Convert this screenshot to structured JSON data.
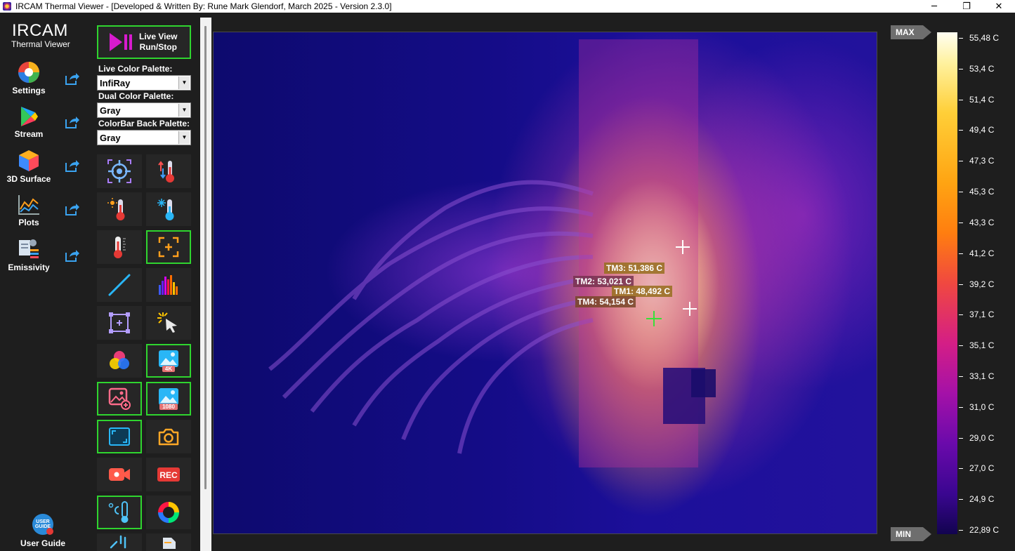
{
  "window": {
    "title": "IRCAM Thermal Viewer - [Developed & Written By: Rune Mark Glendorf, March 2025 - Version 2.3.0]",
    "minimize": "─",
    "maximize": "❐",
    "close": "✕"
  },
  "logo": {
    "title": "IRCAM",
    "subtitle": "Thermal Viewer"
  },
  "nav": [
    {
      "label": "Settings",
      "icon": "settings-icon"
    },
    {
      "label": "Stream",
      "icon": "play-stream-icon"
    },
    {
      "label": "3D Surface",
      "icon": "cube-icon"
    },
    {
      "label": "Plots",
      "icon": "chart-icon"
    },
    {
      "label": "Emissivity",
      "icon": "emissivity-icon"
    }
  ],
  "user_guide": {
    "label": "User Guide",
    "badge_line1": "USER",
    "badge_line2": "GUIDE"
  },
  "live_view": {
    "line1": "Live View",
    "line2": "Run/Stop"
  },
  "palettes": {
    "live_label": "Live Color Palette:",
    "live_value": "InfiRay",
    "dual_label": "Dual Color Palette:",
    "dual_value": "Gray",
    "colorbar_label": "ColorBar Back Palette:",
    "colorbar_value": "Gray"
  },
  "tool_text": {
    "rec": "REC",
    "res4k": "4K",
    "res1080": "1080"
  },
  "measurements": [
    {
      "label": "TM3: 51,386 C"
    },
    {
      "label": "TM2: 53,021 C"
    },
    {
      "label": "TM1: 48,492 C"
    },
    {
      "label": "TM4: 54,154 C"
    }
  ],
  "colorbar": {
    "max_label": "MAX",
    "min_label": "MIN",
    "ticks": [
      "55,48 C",
      "53,4 C",
      "51,4 C",
      "49,4 C",
      "47,3 C",
      "45,3 C",
      "43,3 C",
      "41,2 C",
      "39,2 C",
      "37,1 C",
      "35,1 C",
      "33,1 C",
      "31,0 C",
      "29,0 C",
      "27,0 C",
      "24,9 C",
      "22,89 C"
    ],
    "colors": {
      "top": "#fffef2",
      "bottom": "#12044f"
    }
  },
  "colors": {
    "accent_green": "#2fd52f",
    "background": "#1e1e1e"
  }
}
